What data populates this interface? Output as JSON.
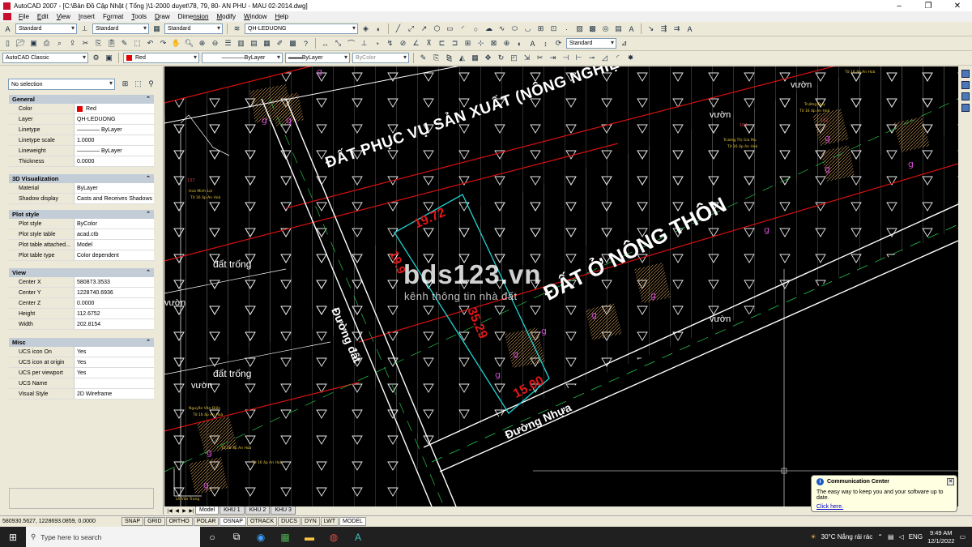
{
  "window": {
    "title": "AutoCAD 2007 - [C:\\Bản Đồ Cập Nhật ( Tổng )\\1-2000 duyet\\78, 79, 80- AN PHU - MAU 02-2014.dwg]",
    "minimize": "–",
    "maximize": "❐",
    "close": "✕"
  },
  "menu": {
    "items": [
      {
        "u": "F",
        "rest": "ile"
      },
      {
        "u": "E",
        "rest": "dit"
      },
      {
        "u": "V",
        "rest": "iew"
      },
      {
        "u": "I",
        "rest": "nsert"
      },
      {
        "u": "F",
        "rest": "o",
        "tail": "rmat"
      },
      {
        "u": "T",
        "rest": "ools"
      },
      {
        "u": "D",
        "rest": "raw"
      },
      {
        "u": "",
        "rest": "Dime",
        "tail": "nsion"
      },
      {
        "u": "M",
        "rest": "odify"
      },
      {
        "u": "W",
        "rest": "indow"
      },
      {
        "u": "H",
        "rest": "elp"
      }
    ]
  },
  "toolbar1": {
    "text_style": "Standard",
    "dim_style": "Standard",
    "table_style": "Standard",
    "layer": "QH-LEDUONG",
    "multileader_style": "Standard"
  },
  "toolbar2": {
    "workspace": "AutoCAD Classic",
    "color": "Red",
    "linetype": "ByLayer",
    "lineweight": "ByLayer",
    "plotstyle": "ByColor"
  },
  "properties": {
    "selection": "No selection",
    "sections": [
      {
        "title": "General",
        "rows": [
          {
            "k": "Color",
            "v": "Red"
          },
          {
            "k": "Layer",
            "v": "QH-LEDUONG"
          },
          {
            "k": "Linetype",
            "v": "———— ByLayer"
          },
          {
            "k": "Linetype scale",
            "v": "1.0000"
          },
          {
            "k": "Lineweight",
            "v": "———— ByLayer"
          },
          {
            "k": "Thickness",
            "v": "0.0000"
          }
        ]
      },
      {
        "title": "3D Visualization",
        "rows": [
          {
            "k": "Material",
            "v": "ByLayer"
          },
          {
            "k": "Shadow display",
            "v": "Casts and Receives Shadows"
          }
        ]
      },
      {
        "title": "Plot style",
        "rows": [
          {
            "k": "Plot style",
            "v": "ByColor"
          },
          {
            "k": "Plot style table",
            "v": "acad.ctb"
          },
          {
            "k": "Plot table attached...",
            "v": "Model"
          },
          {
            "k": "Plot table type",
            "v": "Color dependent"
          }
        ]
      },
      {
        "title": "View",
        "rows": [
          {
            "k": "Center X",
            "v": "580873.3533"
          },
          {
            "k": "Center Y",
            "v": "1228740.6936"
          },
          {
            "k": "Center Z",
            "v": "0.0000"
          },
          {
            "k": "Height",
            "v": "112.6752"
          },
          {
            "k": "Width",
            "v": "202.8154"
          }
        ]
      },
      {
        "title": "Misc",
        "rows": [
          {
            "k": "UCS icon On",
            "v": "Yes"
          },
          {
            "k": "UCS icon at origin",
            "v": "Yes"
          },
          {
            "k": "UCS per viewport",
            "v": "Yes"
          },
          {
            "k": "UCS Name",
            "v": ""
          },
          {
            "k": "Visual Style",
            "v": "2D Wireframe"
          }
        ]
      }
    ]
  },
  "drawing": {
    "zone_production": "ĐẤT PHỤC VỤ SẢN XUẤT (NÔNG NGHIỆP)",
    "zone_residential": "ĐẤT Ở NÔNG THÔN",
    "road_dirt": "Đường đất",
    "road_asphalt": "Đường Nhựa",
    "empty_land_1": "đất trống",
    "empty_land_2": "đất trống",
    "garden_1": "vườn",
    "garden_2": "vườn",
    "garden_3": "vườn",
    "garden_4": "vườn",
    "garden_5": "vườn",
    "dim_top": "19.72",
    "dim_left": "19.9",
    "dim_right_side": "35.29",
    "dim_bottom": "15.00",
    "watermark": "bds123.vn",
    "watermark_sub": "kênh thông tin nhà đất"
  },
  "layout_tabs": {
    "nav": [
      "|◀",
      "◀",
      "▶",
      "▶|"
    ],
    "tabs": [
      "Model",
      "KHU 1",
      "KHU 2",
      "KHU 3"
    ]
  },
  "status": {
    "coords": "580930.5627, 1228693.0859, 0.0000",
    "buttons": [
      "SNAP",
      "GRID",
      "ORTHO",
      "POLAR",
      "OSNAP",
      "OTRACK",
      "DUCS",
      "DYN",
      "LWT",
      "MODEL"
    ]
  },
  "comm_center": {
    "title": "Communication Center",
    "message": "The easy way to keep you and your software up to date.",
    "link": "Click here."
  },
  "taskbar": {
    "search_placeholder": "Type here to search",
    "weather": "30°C  Nắng rải rác",
    "lang": "ENG",
    "time": "9:49 AM",
    "date": "12/1/2022"
  }
}
